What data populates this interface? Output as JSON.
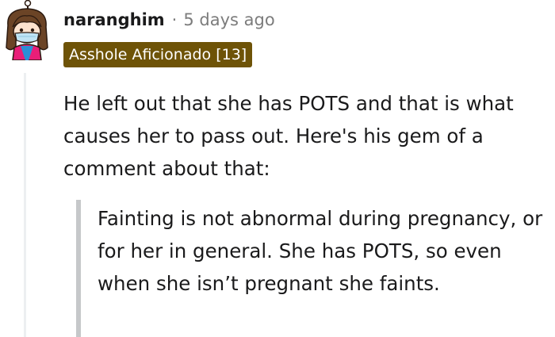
{
  "comment": {
    "author": "naranghim",
    "separator": "·",
    "timestamp": "5 days ago",
    "flair": "Asshole Aficionado [13]",
    "avatar_icon": "snoo-avatar-icon",
    "body": "He left out that she has POTS and that is what causes her to pass out. Here's his gem of a comment about that:",
    "quote": "Fainting is not abnormal during pregnancy, or for her in general. She has POTS, so even when she isn’t pregnant she faints."
  },
  "colors": {
    "flair_background": "#6e5307",
    "flair_text": "#ffffff",
    "meta_text": "#7c7c7c",
    "quote_bar": "#c6c8ca",
    "thread_line": "#edeff1"
  }
}
